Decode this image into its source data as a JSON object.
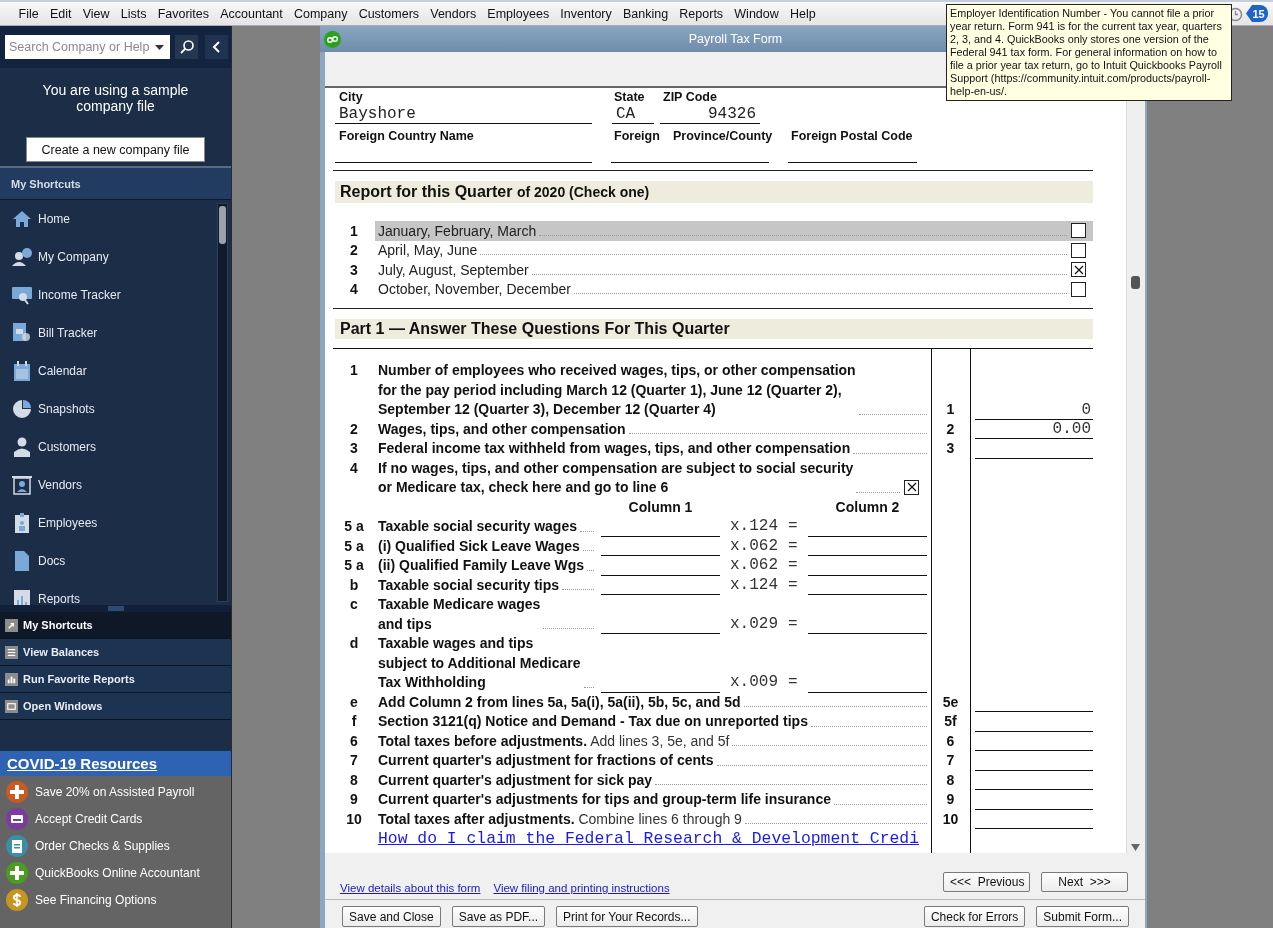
{
  "menu": [
    "File",
    "Edit",
    "View",
    "Lists",
    "Favorites",
    "Accountant",
    "Company",
    "Customers",
    "Vendors",
    "Employees",
    "Inventory",
    "Banking",
    "Reports",
    "Window",
    "Help"
  ],
  "notifications": {
    "count": "15"
  },
  "tooltip": {
    "text": "Employer Identification Number - You cannot file a prior year return. Form 941 is for the current tax year, quarters 2, 3, and 4. QuickBooks only stores one version of the Federal 941 tax form. For general information on how to file a prior year tax return, go to Intuit Quickbooks Payroll Support (https://community.intuit.com/products/payroll-help-en-us/."
  },
  "search": {
    "placeholder": "Search Company or Help"
  },
  "sample_notice": {
    "text": "You are using a sample company file",
    "button": "Create a new company file"
  },
  "shortcuts": {
    "title": "My Shortcuts",
    "items": [
      {
        "label": "Home",
        "kind": "home"
      },
      {
        "label": "My Company",
        "kind": "company"
      },
      {
        "label": "Income Tracker",
        "kind": "income"
      },
      {
        "label": "Bill Tracker",
        "kind": "bill"
      },
      {
        "label": "Calendar",
        "kind": "calendar"
      },
      {
        "label": "Snapshots",
        "kind": "snapshots"
      },
      {
        "label": "Customers",
        "kind": "person"
      },
      {
        "label": "Vendors",
        "kind": "vendor"
      },
      {
        "label": "Employees",
        "kind": "badge"
      },
      {
        "label": "Docs",
        "kind": "doc"
      },
      {
        "label": "Reports",
        "kind": "reports"
      }
    ]
  },
  "nav_tabs": [
    {
      "label": "My Shortcuts",
      "kind": "shortcut",
      "selected": true
    },
    {
      "label": "View Balances",
      "kind": "list",
      "selected": false
    },
    {
      "label": "Run Favorite Reports",
      "kind": "bars",
      "selected": false
    },
    {
      "label": "Open Windows",
      "kind": "window",
      "selected": false
    }
  ],
  "resources": {
    "title": "COVID-19 Resources",
    "items": [
      {
        "label": "Save 20% on Assisted Payroll",
        "kind": "plus",
        "color": "#c85a22"
      },
      {
        "label": "Accept Credit Cards",
        "kind": "card",
        "color": "#7a3d9e"
      },
      {
        "label": "Order Checks & Supplies",
        "kind": "checks",
        "color": "#3b8ea3"
      },
      {
        "label": "QuickBooks Online Accountant",
        "kind": "plus",
        "color": "#4a9e1e"
      },
      {
        "label": "See Financing Options",
        "kind": "dollar",
        "color": "#c8961e"
      }
    ]
  },
  "window": {
    "title": "Payroll Tax Form"
  },
  "form": {
    "address": {
      "city_label": "City",
      "state_label": "State",
      "zip_label": "ZIP Code",
      "city": "Bayshore",
      "state": "CA",
      "zip": "94326",
      "country_label": "Foreign Country Name",
      "foreign_label": "Foreign",
      "province_label": "Province/County",
      "postal_label": "Foreign Postal Code"
    },
    "quarter_section": {
      "title": "Report for this Quarter",
      "subtitle": "of 2020 (Check one)"
    },
    "quarters": [
      {
        "num": "1",
        "label": "January, February, March",
        "checked": false,
        "selected": true
      },
      {
        "num": "2",
        "label": "April, May, June",
        "checked": false,
        "selected": false
      },
      {
        "num": "3",
        "label": "July, August, September",
        "checked": true,
        "selected": false
      },
      {
        "num": "4",
        "label": "October, November, December",
        "checked": false,
        "selected": false
      }
    ],
    "part1": {
      "title": "Part 1 — Answer These Questions For This Quarter",
      "lines": [
        {
          "kind": "line",
          "num": "1",
          "text": [
            "Number of employees who received wages, tips, or other compensation",
            "for the pay period including March 12 (Quarter 1), June 12 (Quarter 2),",
            "September 12 (Quarter 3), December 12 (Quarter 4)"
          ],
          "ref": "1",
          "value": "0"
        },
        {
          "kind": "line",
          "num": "2",
          "text": [
            "Wages, tips, and other compensation"
          ],
          "ref": "2",
          "value": "0.00"
        },
        {
          "kind": "line",
          "num": "3",
          "text": [
            "Federal income tax withheld from wages, tips, and other compensation"
          ],
          "ref": "3"
        },
        {
          "kind": "check",
          "num": "4",
          "text": [
            "If no wages, tips, and other compensation are subject to social security",
            "or Medicare tax, check here and go to line 6"
          ],
          "checked": true
        },
        {
          "kind": "columns",
          "labels": [
            "Column 1",
            "Column 2"
          ]
        },
        {
          "kind": "calc",
          "num": "5 a",
          "text": [
            "Taxable social security wages"
          ],
          "rate": "x.124",
          "equals": "="
        },
        {
          "kind": "calc",
          "num": "5 a",
          "text": [
            "(i)  Qualified Sick Leave Wages"
          ],
          "rate": "x.062",
          "equals": "="
        },
        {
          "kind": "calc",
          "num": "5 a",
          "text": [
            "(ii)  Qualified Family Leave Wgs"
          ],
          "rate": "x.062",
          "equals": "="
        },
        {
          "kind": "calc",
          "num": "b",
          "text": [
            "Taxable social security tips"
          ],
          "rate": "x.124",
          "equals": "="
        },
        {
          "kind": "calc",
          "num": "c",
          "text": [
            "Taxable Medicare wages",
            "and tips"
          ],
          "rate": "x.029",
          "equals": "="
        },
        {
          "kind": "calc",
          "num": "d",
          "text": [
            "Taxable wages and tips",
            "subject to Additional Medicare",
            "Tax Withholding"
          ],
          "rate": "x.009",
          "equals": "="
        },
        {
          "kind": "line",
          "num": "e",
          "text": [
            "Add Column 2 from lines 5a, 5a(i), 5a(ii), 5b, 5c, and 5d"
          ],
          "ref": "5e"
        },
        {
          "kind": "line",
          "num": "f",
          "text": [
            "Section 3121(q) Notice and Demand - Tax due on unreported tips"
          ],
          "ref": "5f"
        },
        {
          "kind": "line",
          "num": "6",
          "text": [
            "**Total taxes before adjustments.** Add lines 3, 5e, and 5f"
          ],
          "partly_bold": true,
          "ref": "6"
        },
        {
          "kind": "line",
          "num": "7",
          "text": [
            "Current quarter's adjustment for fractions of cents"
          ],
          "ref": "7"
        },
        {
          "kind": "line",
          "num": "8",
          "text": [
            "Current quarter's adjustment for sick pay"
          ],
          "ref": "8"
        },
        {
          "kind": "line",
          "num": "9",
          "text": [
            "Current quarter's adjustments for tips and group-term life insurance"
          ],
          "ref": "9"
        },
        {
          "kind": "line",
          "num": "10",
          "text": [
            "**Total taxes after adjustments.** Combine lines 6 through 9"
          ],
          "partly_bold": true,
          "ref": "10"
        },
        {
          "kind": "link",
          "text": "How do I claim the Federal Research & Development Credi"
        }
      ]
    }
  },
  "footer": {
    "links": [
      "View details about this form",
      "View filing and printing instructions"
    ],
    "nav_buttons": [
      "<<<  Previous",
      "Next  >>>"
    ],
    "left_buttons": [
      "Save and Close",
      "Save as PDF...",
      "Print for Your Records..."
    ],
    "right_buttons": [
      "Check for Errors",
      "Submit Form..."
    ]
  }
}
